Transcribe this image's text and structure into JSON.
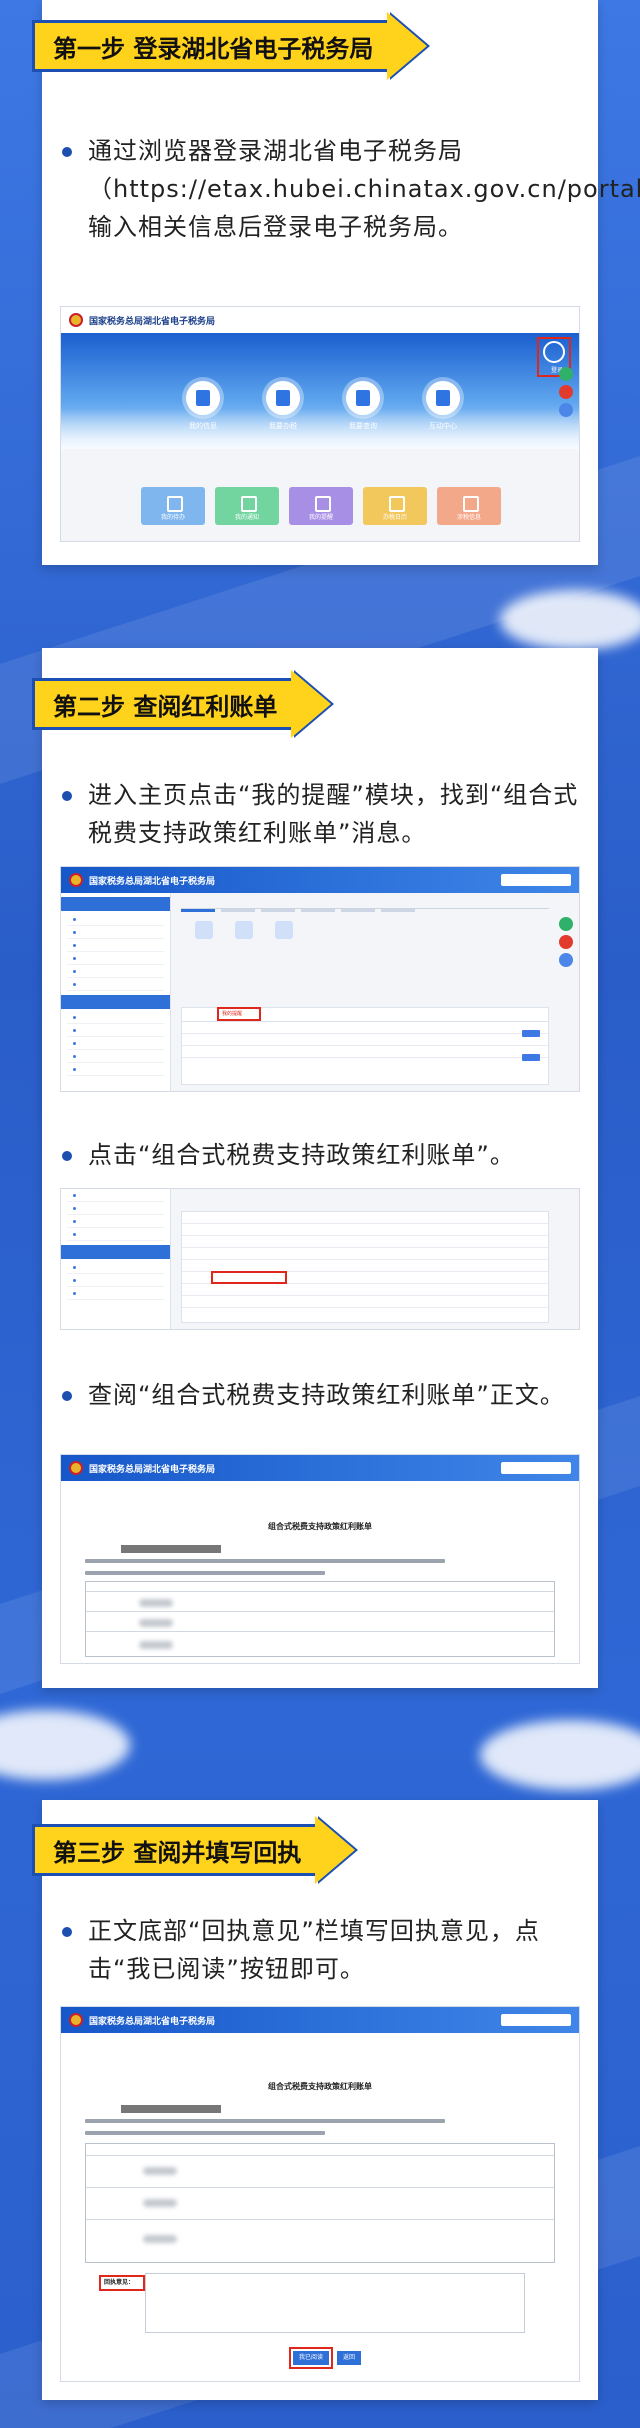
{
  "colors": {
    "banner_fill": "#ffd21c",
    "banner_border": "#1b4fb4",
    "page_bg": "#2e63cf",
    "highlight": "#e1261c"
  },
  "steps": [
    {
      "title": "第一步  登录湖北省电子税务局",
      "bullets": [
        "通过浏览器登录湖北省电子税务局（https://etax.hubei.chinatax.gov.cn/portal/），输入相关信息后登录电子税务局。"
      ]
    },
    {
      "title": "第二步  查阅红利账单",
      "bullets": [
        "进入主页点击“我的提醒”模块，找到“组合式税费支持政策红利账单”消息。",
        "点击“组合式税费支持政策红利账单”。",
        "查阅“组合式税费支持政策红利账单”正文。"
      ]
    },
    {
      "title": "第三步  查阅并填写回执",
      "bullets": [
        "正文底部“回执意见”栏填写回执意见，点击“我已阅读”按钮即可。"
      ]
    }
  ],
  "shots": {
    "header_title": "国家税务总局湖北省电子税务局",
    "hero_icons": [
      "我的信息",
      "我要办税",
      "我要查询",
      "互动中心"
    ],
    "hero_tiles": [
      "我的待办",
      "我的通知",
      "我的提醒",
      "办税日历",
      "涉税信息"
    ],
    "login_label": "登录",
    "doc_title": "组合式税费支持政策红利账单",
    "reply_label": "回执意见：",
    "read_button": "我已阅读",
    "return_button": "返回",
    "tab_remind": "我的提醒"
  }
}
